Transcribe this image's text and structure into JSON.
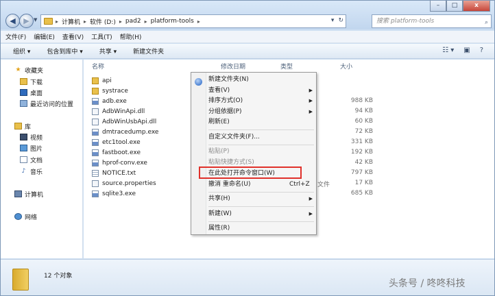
{
  "window": {
    "controls": {
      "minimize": "–",
      "maximize": "□",
      "close": "x"
    }
  },
  "nav": {
    "back": "◀",
    "forward": "▶",
    "dropdown": "▼"
  },
  "address": {
    "crumbs": [
      "计算机",
      "软件 (D:)",
      "pad2",
      "platform-tools"
    ],
    "sep": "▸",
    "dropdown": "▾",
    "refresh": "↻"
  },
  "search": {
    "placeholder": "搜索 platform-tools",
    "icon": "⌕"
  },
  "menubar": [
    "文件(F)",
    "编辑(E)",
    "查看(V)",
    "工具(T)",
    "帮助(H)"
  ],
  "toolbar": {
    "organize": "组织 ▾",
    "include": "包含到库中 ▾",
    "share": "共享 ▾",
    "new_folder": "新建文件夹",
    "view_icon": "☷ ▾",
    "pane_icon": "▣",
    "help_icon": "?"
  },
  "sidebar": {
    "favorites": "收藏夹",
    "downloads": "下载",
    "desktop": "桌面",
    "recent": "最近访问的位置",
    "libraries": "库",
    "videos": "视频",
    "pictures": "图片",
    "documents": "文档",
    "music": "音乐",
    "computer": "计算机",
    "network": "网络"
  },
  "columns": {
    "name": "名称",
    "date": "修改日期",
    "type": "类型",
    "size": "大小"
  },
  "files": [
    {
      "name": "api",
      "kind": "folder",
      "size": ""
    },
    {
      "name": "systrace",
      "kind": "folder",
      "size": ""
    },
    {
      "name": "adb.exe",
      "kind": "exe",
      "size": "988 KB"
    },
    {
      "name": "AdbWinApi.dll",
      "kind": "dll",
      "size": "94 KB"
    },
    {
      "name": "AdbWinUsbApi.dll",
      "kind": "dll",
      "size": "60 KB"
    },
    {
      "name": "dmtracedump.exe",
      "kind": "exe",
      "size": "72 KB"
    },
    {
      "name": "etc1tool.exe",
      "kind": "exe",
      "size": "331 KB"
    },
    {
      "name": "fastboot.exe",
      "kind": "exe",
      "size": "192 KB"
    },
    {
      "name": "hprof-conv.exe",
      "kind": "exe",
      "size": "42 KB"
    },
    {
      "name": "NOTICE.txt",
      "kind": "txt",
      "size": "797 KB"
    },
    {
      "name": "source.properties",
      "kind": "file",
      "size": "17 KB"
    },
    {
      "name": "sqlite3.exe",
      "kind": "exe",
      "size": "685 KB"
    }
  ],
  "type_fragment": "文件",
  "context_menu": {
    "new_folder": "新建文件夹(N)",
    "view": "查看(V)",
    "sort": "排序方式(O)",
    "group": "分组依据(P)",
    "refresh": "刷新(E)",
    "customize": "自定义文件夹(F)...",
    "paste": "粘贴(P)",
    "paste_shortcut": "粘贴快捷方式(S)",
    "open_cmd": "在此处打开命令窗口(W)",
    "undo_rename": "撤消 重命名(U)",
    "undo_shortcut": "Ctrl+Z",
    "share": "共享(H)",
    "new": "新建(W)",
    "properties": "属性(R)",
    "submenu_arrow": "▶"
  },
  "details": {
    "count": "12 个对象"
  },
  "watermark": "头条号 / 咚咚科技",
  "colors": {
    "highlight_border": "#e0302a",
    "window_frame": "#cfe0f2"
  }
}
